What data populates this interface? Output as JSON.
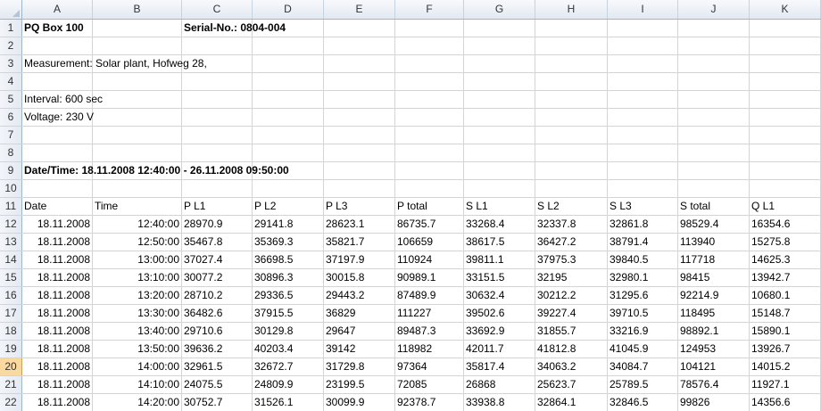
{
  "columns": [
    "A",
    "B",
    "C",
    "D",
    "E",
    "F",
    "G",
    "H",
    "I",
    "J",
    "K"
  ],
  "selected_row": "20",
  "header_rows": {
    "r1": {
      "num": "1",
      "a": "PQ Box 100",
      "c": "Serial-No.: 0804-004"
    },
    "r2": {
      "num": "2"
    },
    "r3": {
      "num": "3",
      "a": "Measurement: Solar plant, Hofweg 28,"
    },
    "r4": {
      "num": "4"
    },
    "r5": {
      "num": "5",
      "a": "Interval: 600 sec"
    },
    "r6": {
      "num": "6",
      "a": "Voltage: 230 V"
    },
    "r7": {
      "num": "7"
    },
    "r8": {
      "num": "8"
    },
    "r9": {
      "num": "9",
      "a": "Date/Time: 18.11.2008 12:40:00 - 26.11.2008 09:50:00"
    },
    "r10": {
      "num": "10"
    },
    "r11": {
      "num": "11",
      "cells": [
        "Date",
        "Time",
        "P L1",
        "P L2",
        "P L3",
        "P total",
        "S L1",
        "S L2",
        "S L3",
        "S total",
        "Q L1"
      ]
    }
  },
  "rows": [
    {
      "num": "12",
      "cells": [
        "18.11.2008",
        "12:40:00",
        "28970.9",
        "29141.8",
        "28623.1",
        "86735.7",
        "33268.4",
        "32337.8",
        "32861.8",
        "98529.4",
        "16354.6"
      ]
    },
    {
      "num": "13",
      "cells": [
        "18.11.2008",
        "12:50:00",
        "35467.8",
        "35369.3",
        "35821.7",
        "106659",
        "38617.5",
        "36427.2",
        "38791.4",
        "113940",
        "15275.8"
      ]
    },
    {
      "num": "14",
      "cells": [
        "18.11.2008",
        "13:00:00",
        "37027.4",
        "36698.5",
        "37197.9",
        "110924",
        "39811.1",
        "37975.3",
        "39840.5",
        "117718",
        "14625.3"
      ]
    },
    {
      "num": "15",
      "cells": [
        "18.11.2008",
        "13:10:00",
        "30077.2",
        "30896.3",
        "30015.8",
        "90989.1",
        "33151.5",
        "32195",
        "32980.1",
        "98415",
        "13942.7"
      ]
    },
    {
      "num": "16",
      "cells": [
        "18.11.2008",
        "13:20:00",
        "28710.2",
        "29336.5",
        "29443.2",
        "87489.9",
        "30632.4",
        "30212.2",
        "31295.6",
        "92214.9",
        "10680.1"
      ]
    },
    {
      "num": "17",
      "cells": [
        "18.11.2008",
        "13:30:00",
        "36482.6",
        "37915.5",
        "36829",
        "111227",
        "39502.6",
        "39227.4",
        "39710.5",
        "118495",
        "15148.7"
      ]
    },
    {
      "num": "18",
      "cells": [
        "18.11.2008",
        "13:40:00",
        "29710.6",
        "30129.8",
        "29647",
        "89487.3",
        "33692.9",
        "31855.7",
        "33216.9",
        "98892.1",
        "15890.1"
      ]
    },
    {
      "num": "19",
      "cells": [
        "18.11.2008",
        "13:50:00",
        "39636.2",
        "40203.4",
        "39142",
        "118982",
        "42011.7",
        "41812.8",
        "41045.9",
        "124953",
        "13926.7"
      ]
    },
    {
      "num": "20",
      "cells": [
        "18.11.2008",
        "14:00:00",
        "32961.5",
        "32672.7",
        "31729.8",
        "97364",
        "35817.4",
        "34063.2",
        "34084.7",
        "104121",
        "14015.2"
      ]
    },
    {
      "num": "21",
      "cells": [
        "18.11.2008",
        "14:10:00",
        "24075.5",
        "24809.9",
        "23199.5",
        "72085",
        "26868",
        "25623.7",
        "25789.5",
        "78576.4",
        "11927.1"
      ]
    },
    {
      "num": "22",
      "cells": [
        "18.11.2008",
        "14:20:00",
        "30752.7",
        "31526.1",
        "30099.9",
        "92378.7",
        "33938.8",
        "32864.1",
        "32846.5",
        "99826",
        "14356.6"
      ]
    }
  ]
}
